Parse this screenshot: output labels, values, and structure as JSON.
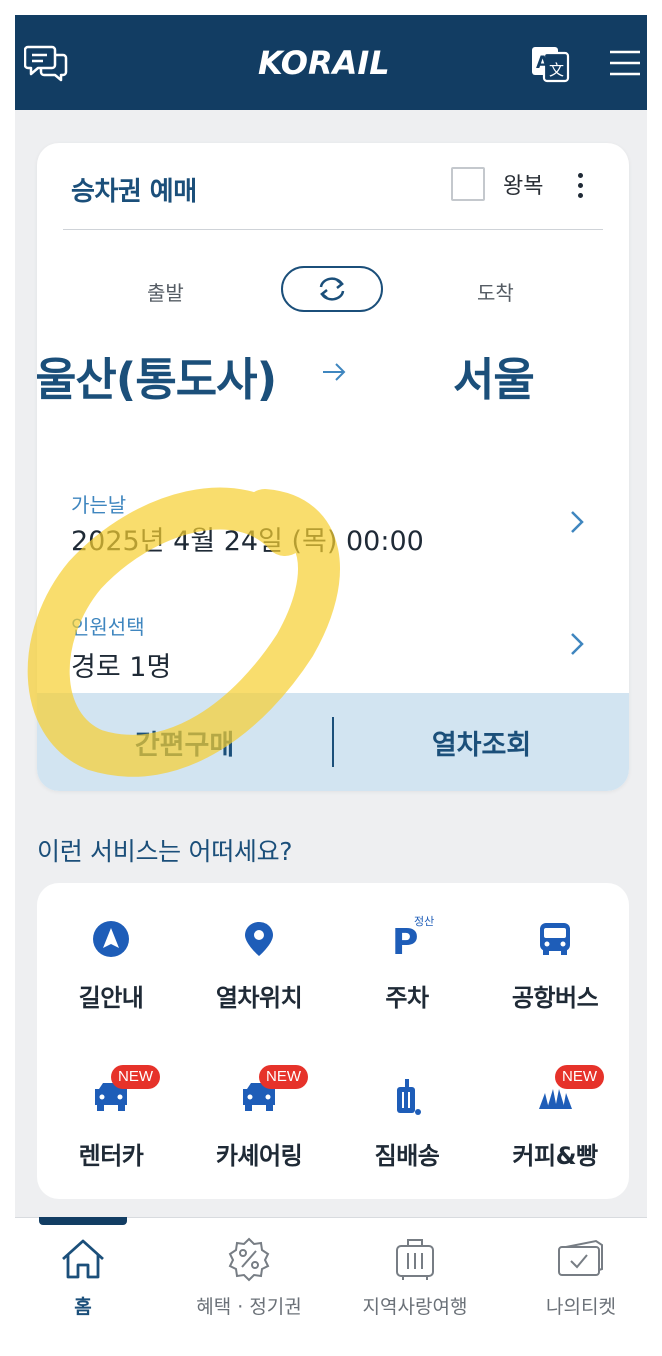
{
  "header": {
    "logo_text": "KORAIL",
    "chat_icon": "chat-icon",
    "translate_icon": "translate-icon",
    "menu_icon": "hamburger-menu-icon"
  },
  "booking": {
    "title": "승차권 예매",
    "roundtrip_label": "왕복",
    "roundtrip_checked": false,
    "departure_label": "출발",
    "arrival_label": "도착",
    "departure_station": "울산(통도사)",
    "arrival_station": "서울",
    "date_label": "가는날",
    "date_value": "2025년 4월 24일 (목) 00:00",
    "passenger_label": "인원선택",
    "passenger_value": "경로 1명",
    "quick_buy_label": "간편구매",
    "train_search_label": "열차조회"
  },
  "services": {
    "title": "이런 서비스는 어떠세요?",
    "new_badge": "NEW",
    "parking_badge": "정산",
    "items": [
      {
        "label": "길안내",
        "icon": "navigation-icon",
        "is_new": false
      },
      {
        "label": "열차위치",
        "icon": "location-pin-icon",
        "is_new": false
      },
      {
        "label": "주차",
        "icon": "parking-icon",
        "is_new": false
      },
      {
        "label": "공항버스",
        "icon": "bus-icon",
        "is_new": false
      },
      {
        "label": "렌터카",
        "icon": "car-icon",
        "is_new": true
      },
      {
        "label": "카셰어링",
        "icon": "car-share-icon",
        "is_new": true
      },
      {
        "label": "짐배송",
        "icon": "luggage-icon",
        "is_new": false
      },
      {
        "label": "커피&빵",
        "icon": "coffee-bread-icon",
        "is_new": true
      }
    ]
  },
  "bottom_nav": {
    "items": [
      {
        "label": "홈",
        "icon": "home-icon",
        "active": true
      },
      {
        "label": "혜택 · 정기권",
        "icon": "discount-badge-icon",
        "active": false
      },
      {
        "label": "지역사랑여행",
        "icon": "suitcase-icon",
        "active": false
      },
      {
        "label": "나의티켓",
        "icon": "ticket-icon",
        "active": false
      }
    ]
  },
  "colors": {
    "brand_navy": "#123d63",
    "primary_blue": "#1b4f7a",
    "label_blue": "#3f86bf",
    "icon_blue": "#1e5db8",
    "action_bar": "#d2e4f1",
    "badge_red": "#e6322a",
    "highlight_yellow": "#f7cf2f"
  }
}
